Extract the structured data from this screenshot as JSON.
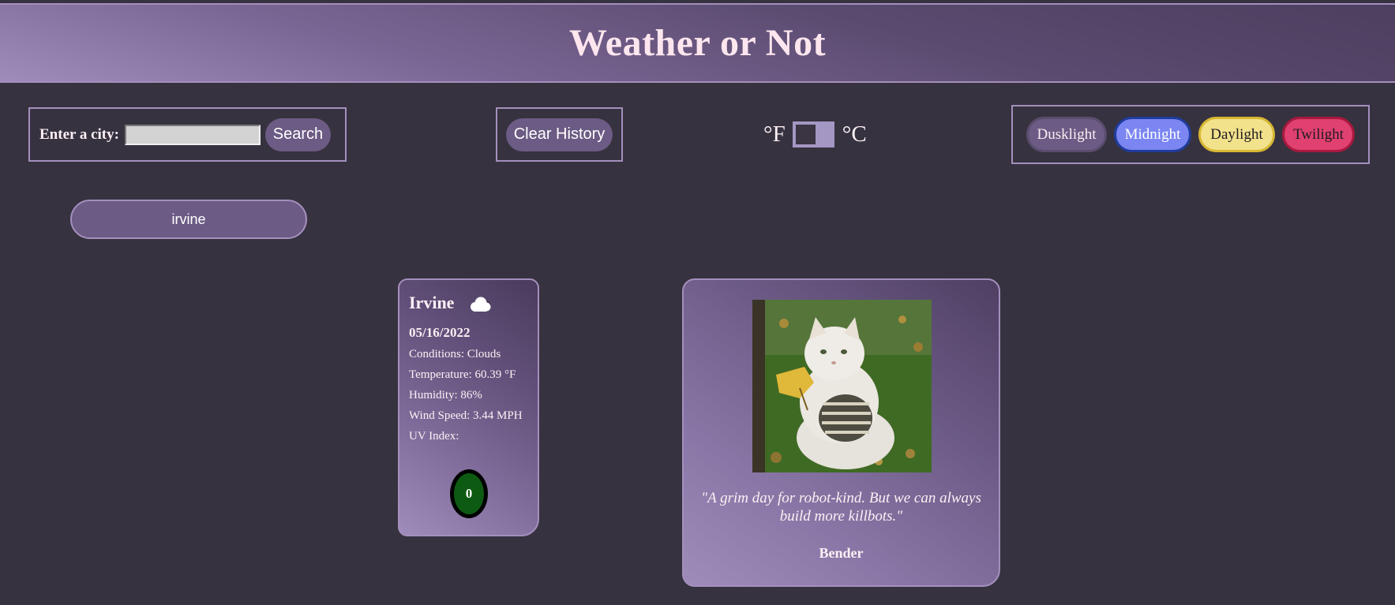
{
  "header": {
    "title": "Weather or Not"
  },
  "search": {
    "label": "Enter a city:",
    "value": "",
    "placeholder": "",
    "button_label": "Search"
  },
  "history": {
    "clear_label": "Clear History",
    "items": [
      "irvine"
    ]
  },
  "units": {
    "fahrenheit_label": "°F",
    "celsius_label": "°C",
    "selected": "°F"
  },
  "themes": [
    {
      "label": "Dusklight",
      "color": "#6c5b84"
    },
    {
      "label": "Midnight",
      "color": "#7b86f2"
    },
    {
      "label": "Daylight",
      "color": "#f3e28c"
    },
    {
      "label": "Twilight",
      "color": "#e04171"
    }
  ],
  "weather": {
    "city": "Irvine",
    "icon": "cloud-icon",
    "date": "05/16/2022",
    "conditions": "Conditions: Clouds",
    "temperature": "Temperature: 60.39 °F",
    "humidity": "Humidity: 86%",
    "wind": "Wind Speed: 3.44 MPH",
    "uv_label": "UV Index:",
    "uv_value": "0",
    "uv_color": "#0d5b12"
  },
  "quote": {
    "image": "cat-photo",
    "text": "\"A grim day for robot-kind. But we can always build more killbots.\"",
    "author": "Bender"
  }
}
